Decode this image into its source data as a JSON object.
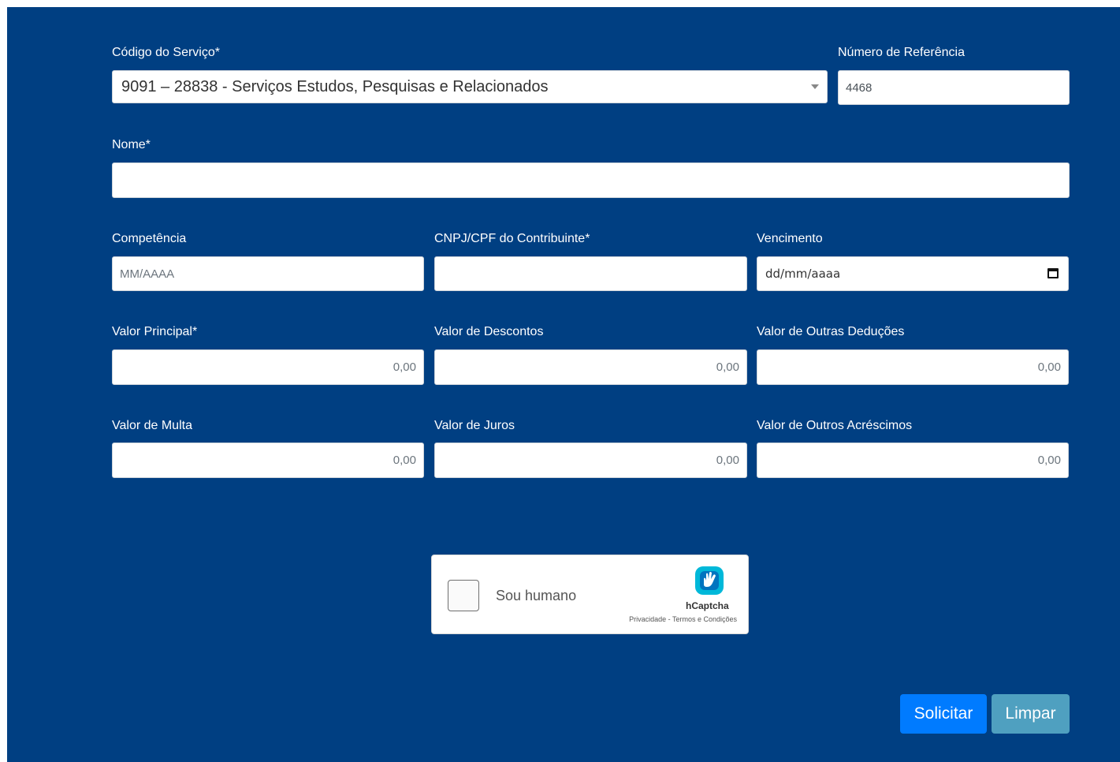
{
  "form": {
    "servico": {
      "label": "Código do Serviço*",
      "value": "9091 – 28838 - Serviços Estudos, Pesquisas e Relacionados"
    },
    "referencia": {
      "label": "Número de Referência",
      "value": "4468"
    },
    "nome": {
      "label": "Nome*",
      "value": ""
    },
    "competencia": {
      "label": "Competência",
      "placeholder": "MM/AAAA"
    },
    "cnpj": {
      "label": "CNPJ/CPF do Contribuinte*",
      "value": ""
    },
    "vencimento": {
      "label": "Vencimento",
      "placeholder": "dd/mm/aaaa"
    },
    "valor_principal": {
      "label": "Valor Principal*",
      "placeholder": "0,00"
    },
    "valor_descontos": {
      "label": "Valor de Descontos",
      "placeholder": "0,00"
    },
    "valor_outras_deducoes": {
      "label": "Valor de Outras Deduções",
      "placeholder": "0,00"
    },
    "valor_multa": {
      "label": "Valor de Multa",
      "placeholder": "0,00"
    },
    "valor_juros": {
      "label": "Valor de Juros",
      "placeholder": "0,00"
    },
    "valor_outros_acrescimos": {
      "label": "Valor de Outros Acréscimos",
      "placeholder": "0,00"
    }
  },
  "captcha": {
    "checkbox_label": "Sou humano",
    "brand": "hCaptcha",
    "privacy_link": "Privacidade",
    "separator": " - ",
    "terms_link": "Termos e Condições",
    "logo_icon": "hcaptcha-hand-icon"
  },
  "buttons": {
    "submit": "Solicitar",
    "clear": "Limpar"
  },
  "colors": {
    "panel_bg": "#003f82",
    "primary": "#007bff",
    "info": "#4fa0c0",
    "captcha_logo": "#00b8d9"
  }
}
